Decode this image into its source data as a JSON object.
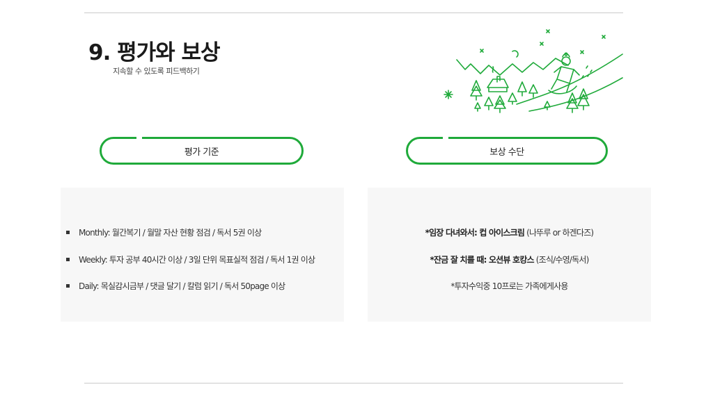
{
  "header": {
    "title": "9. 평가와 보상",
    "subtitle": "지속할 수 있도록 피드백하기"
  },
  "sections": {
    "evaluation_label": "평가 기준",
    "reward_label": "보상 수단"
  },
  "evaluation_items": [
    "Monthly: 월간복기 / 월말 자산 현황 점검 / 독서 5권 이상",
    "Weekly: 투자 공부 40시간 이상 / 3일 단위 목표실적 점검 / 독서 1권 이상",
    "Daily: 목실감시금부 / 댓글 달기 / 칼럼 읽기 / 독서 50page 이상"
  ],
  "rewards": [
    {
      "bold": "*임장 다녀와서: 컵 아이스크림",
      "normal": " (나뚜루 or 하겐다즈)"
    },
    {
      "bold": "*잔금 잘 치를 때: 오션뷰 호캉스",
      "normal": " (조식/수영/독서)"
    },
    {
      "bold": "",
      "normal": "*투자수익중 10프로는 가족에게사용"
    }
  ],
  "colors": {
    "accent": "#1faa3a",
    "panel": "#f7f7f7",
    "rule": "#c9c9c9"
  },
  "icons": {
    "illustration": "winter-sledding-illustration"
  }
}
